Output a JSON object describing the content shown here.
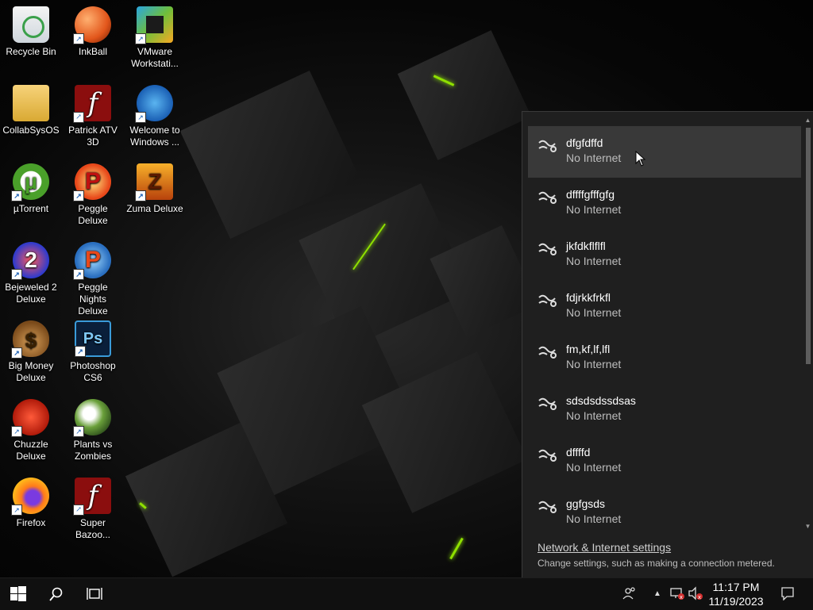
{
  "desktop": {
    "icons": [
      {
        "label": "Recycle Bin"
      },
      {
        "label": "InkBall"
      },
      {
        "label": "VMware Workstati..."
      },
      {
        "label": "CollabSysOS"
      },
      {
        "label": "Patrick ATV 3D"
      },
      {
        "label": "Welcome to Windows ..."
      },
      {
        "label": "µTorrent"
      },
      {
        "label": "Peggle Deluxe"
      },
      {
        "label": "Zuma Deluxe"
      },
      {
        "label": "Bejeweled 2 Deluxe"
      },
      {
        "label": "Peggle Nights Deluxe"
      },
      {
        "label": "Big Money Deluxe"
      },
      {
        "label": "Photoshop CS6"
      },
      {
        "label": "Chuzzle Deluxe"
      },
      {
        "label": "Plants vs Zombies"
      },
      {
        "label": "Firefox"
      },
      {
        "label": "Super Bazoo..."
      }
    ]
  },
  "network_flyout": {
    "networks": [
      {
        "name": "dfgfdffd",
        "status": "No Internet"
      },
      {
        "name": "dffffgfffgfg",
        "status": "No Internet"
      },
      {
        "name": "jkfdkflflfl",
        "status": "No Internet"
      },
      {
        "name": "fdjrkkfrkfl",
        "status": "No Internet"
      },
      {
        "name": "fm,kf,lf,lfl",
        "status": "No Internet"
      },
      {
        "name": "sdsdsdssdsas",
        "status": "No Internet"
      },
      {
        "name": "dffffd",
        "status": "No Internet"
      },
      {
        "name": "ggfgsds",
        "status": "No Internet"
      }
    ],
    "settings_link": "Network & Internet settings",
    "settings_desc": "Change settings, such as making a connection metered."
  },
  "taskbar": {
    "time": "11:17 PM",
    "date": "11/19/2023"
  },
  "colors": {
    "flyout_bg": "#1f1f1f",
    "hover_bg": "#393939",
    "taskbar_bg": "#101010",
    "accent_green": "#8fe000"
  }
}
